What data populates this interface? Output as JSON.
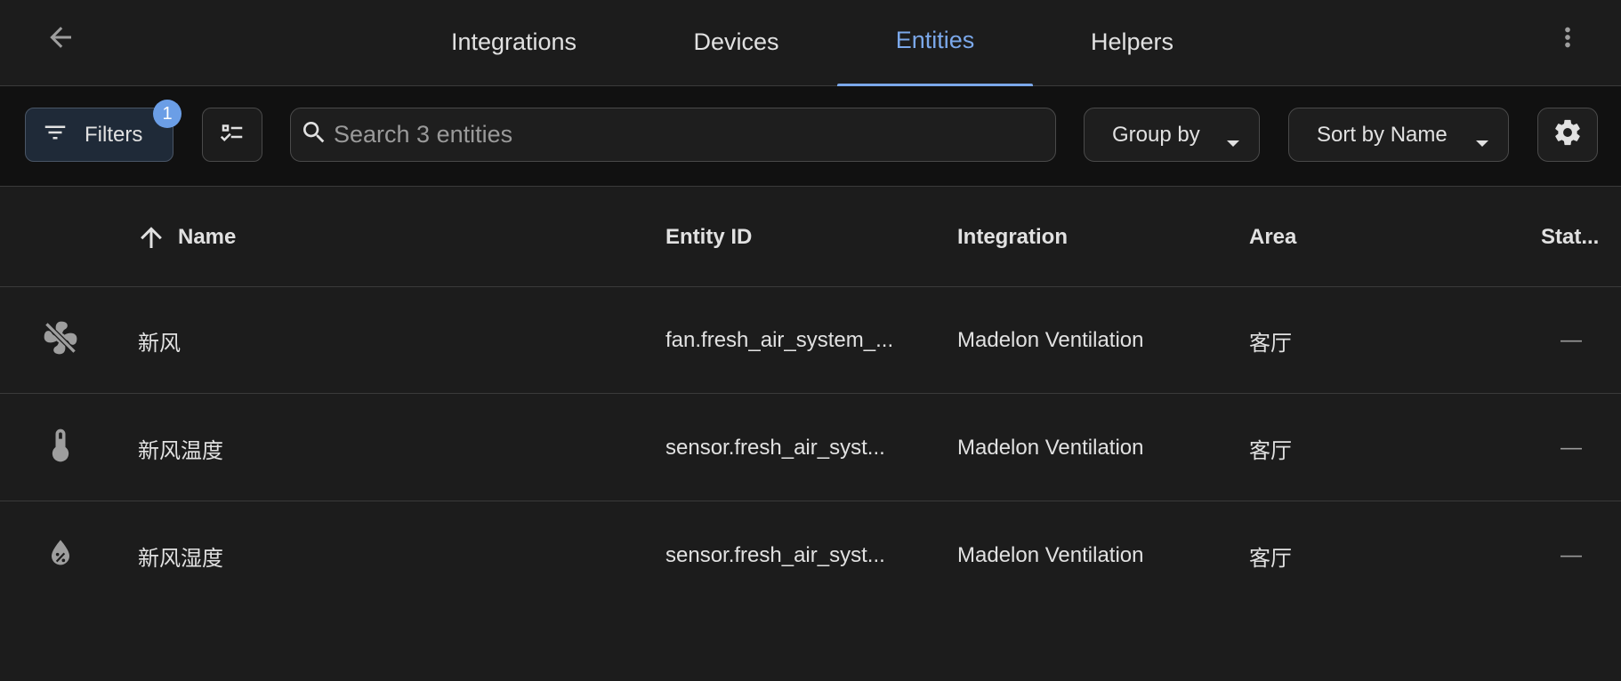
{
  "nav": {
    "tabs": [
      {
        "label": "Integrations",
        "active": false
      },
      {
        "label": "Devices",
        "active": false
      },
      {
        "label": "Entities",
        "active": true
      },
      {
        "label": "Helpers",
        "active": false
      }
    ]
  },
  "toolbar": {
    "filters_label": "Filters",
    "filters_count": "1",
    "search_placeholder": "Search 3 entities",
    "search_value": "",
    "group_by_label": "Group by",
    "sort_by_label": "Sort by Name"
  },
  "table": {
    "columns": {
      "name": "Name",
      "entity_id": "Entity ID",
      "integration": "Integration",
      "area": "Area",
      "status": "Stat..."
    },
    "sort": {
      "column": "name",
      "direction": "ascending"
    },
    "rows": [
      {
        "icon": "fan-icon",
        "name": "新风",
        "entity_id": "fan.fresh_air_system_...",
        "integration": "Madelon Ventilation",
        "area": "客厅",
        "status": "—"
      },
      {
        "icon": "thermometer-icon",
        "name": "新风温度",
        "entity_id": "sensor.fresh_air_syst...",
        "integration": "Madelon Ventilation",
        "area": "客厅",
        "status": "—"
      },
      {
        "icon": "water-percent-icon",
        "name": "新风湿度",
        "entity_id": "sensor.fresh_air_syst...",
        "integration": "Madelon Ventilation",
        "area": "客厅",
        "status": "—"
      }
    ]
  },
  "colors": {
    "accent": "#7ba8ea",
    "badge": "#6b9ee6",
    "background": "#1c1c1c",
    "toolbar_background": "#111111",
    "filters_background": "#1f2a38"
  }
}
